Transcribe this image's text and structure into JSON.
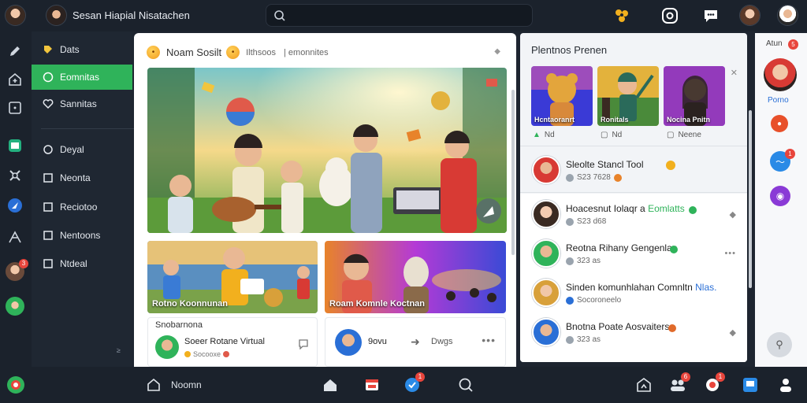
{
  "topbar": {
    "app_title": "Sesan Hiapial Nisatachen",
    "search_placeholder": ""
  },
  "sidebar": {
    "items": [
      {
        "label": "Dats",
        "icon": "tag-icon"
      },
      {
        "label": "Eomnitas",
        "icon": "chat-icon",
        "active": true
      },
      {
        "label": "Sannitas",
        "icon": "heart-icon"
      },
      {
        "label": "Deyal",
        "icon": "circle-icon"
      },
      {
        "label": "Neonta",
        "icon": "square-icon"
      },
      {
        "label": "Reciotoo",
        "icon": "square-icon"
      },
      {
        "label": "Nentoons",
        "icon": "square-icon"
      },
      {
        "label": "Ntdeal",
        "icon": "square-icon"
      }
    ],
    "collapse_label": "≥"
  },
  "rail": {
    "badge": "3"
  },
  "feed": {
    "header_title": "Noam Sosilt",
    "header_tag1": "Ilthsoos",
    "header_tag2": "| emonnites",
    "thumbs": [
      {
        "caption": "Rotno Koonnunan"
      },
      {
        "caption": "Roam Komnle Koctnan"
      }
    ],
    "post1": {
      "section": "Snobarnona",
      "name": "Soeer Rotane Virtual",
      "meta": "Socooxe"
    },
    "post2": {
      "name": "9ovu",
      "meta": "Dwgs"
    }
  },
  "rpanel": {
    "title": "Plentnos Prenen",
    "cards": [
      {
        "caption": "Hcntaoranrt"
      },
      {
        "caption": "Ronitals"
      },
      {
        "caption": "Nocina Pnitn"
      }
    ],
    "stats": [
      "Nd",
      "Nd",
      "Neene"
    ],
    "featured": {
      "name": "Sleolte Stancl Tool",
      "meta": "S23 7628"
    },
    "people": [
      {
        "name": "Hoacesnut Iolaqr a",
        "highlight": "Eomlatts",
        "meta": "S23 d68",
        "dot": "#2fb35a"
      },
      {
        "name": "Reotna Rihany Gengenlan",
        "highlight": "",
        "meta": "323 as",
        "dot": "#2fb35a"
      },
      {
        "name": "Sinden komunhlahan Comnltn",
        "highlight": "Nlas.",
        "meta": "Socoroneelo",
        "dot": "#2a6fd6"
      },
      {
        "name": "Bnotna Poate Aosvaiters",
        "highlight": "",
        "meta": "323 as",
        "dot": "#e06a2a"
      }
    ]
  },
  "farcol": {
    "label": "Atun",
    "badge1": "5",
    "name": "Porno",
    "badge2": "1"
  },
  "bottombar": {
    "home_label": "Noomn",
    "badge1": "1",
    "badge2": "6",
    "badge3": "1"
  },
  "colors": {
    "accent": "#2fb35a",
    "badge": "#e8453c",
    "dark": "#1b222c"
  }
}
